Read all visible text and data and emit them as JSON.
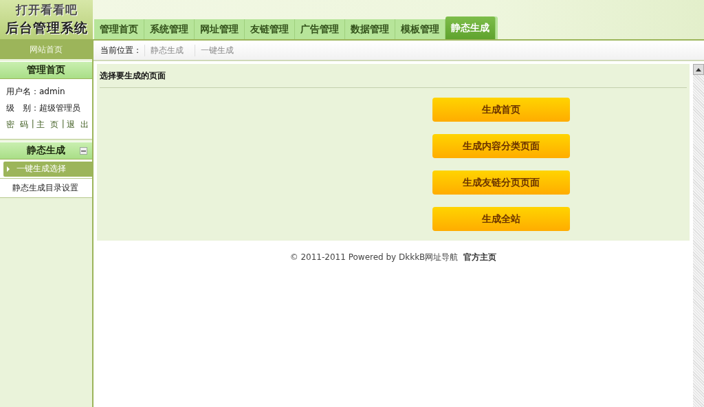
{
  "logo": {
    "line1": "打开看看吧",
    "line2": "后台管理系统"
  },
  "tabs": [
    {
      "label": "管理首页",
      "selected": false
    },
    {
      "label": "系统管理",
      "selected": false
    },
    {
      "label": "网址管理",
      "selected": false
    },
    {
      "label": "友链管理",
      "selected": false
    },
    {
      "label": "广告管理",
      "selected": false
    },
    {
      "label": "数据管理",
      "selected": false
    },
    {
      "label": "模板管理",
      "selected": false
    },
    {
      "label": "静态生成",
      "selected": true
    }
  ],
  "sidebar": {
    "site_home": "网站首页",
    "home_header": "管理首页",
    "user_lines": [
      "用户名：admin",
      "级　别：超级管理员"
    ],
    "user_links": [
      "密 码",
      "主 页",
      "退 出"
    ],
    "link_separator": "|",
    "section": {
      "title": "静态生成",
      "expanded": true,
      "items": [
        {
          "label": "一键生成选择",
          "selected": true
        },
        {
          "label": "静态生成目录设置",
          "selected": false
        }
      ]
    }
  },
  "breadcrumb": {
    "label": "当前位置：",
    "crumbs": [
      "静态生成",
      "一键生成"
    ]
  },
  "panel": {
    "title": "选择要生成的页面",
    "buttons": [
      "生成首页",
      "生成内容分类页面",
      "生成友链分页页面",
      "生成全站"
    ]
  },
  "footer": {
    "text": "© 2011-2011 Powered by DkkkB网址导航",
    "link": "官方主页"
  }
}
